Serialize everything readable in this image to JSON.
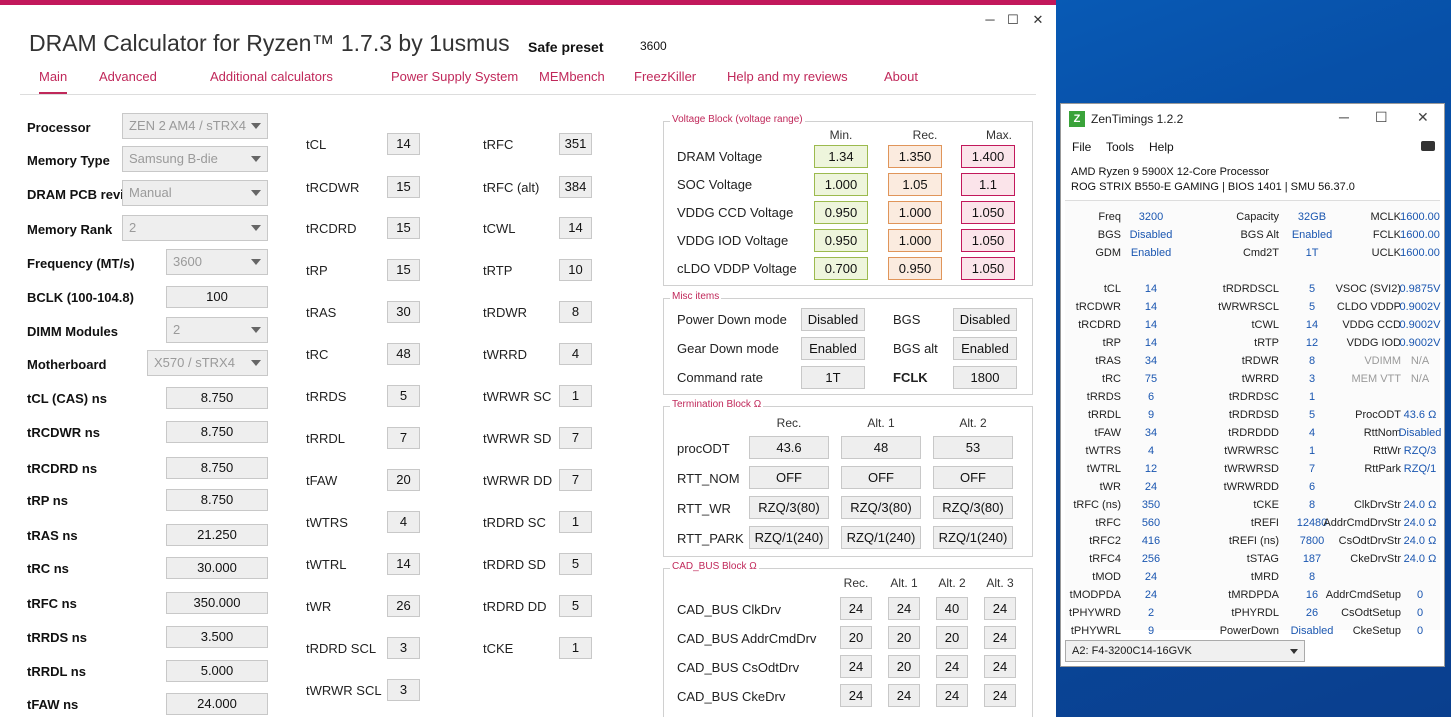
{
  "calc": {
    "title": "DRAM Calculator for Ryzen™ 1.7.3 by 1usmus",
    "preset_label": "Safe preset",
    "preset_value": "3600",
    "tabs": [
      "Main",
      "Advanced",
      "Additional calculators",
      "Power Supply System",
      "MEMbench",
      "FreezKiller",
      "Help and my reviews",
      "About"
    ],
    "settings": [
      {
        "label": "Processor",
        "value": "ZEN 2 AM4 / sTRX4",
        "type": "select"
      },
      {
        "label": "Memory Type",
        "value": "Samsung B-die",
        "type": "select"
      },
      {
        "label": "DRAM PCB revision",
        "value": "Manual",
        "type": "select"
      },
      {
        "label": "Memory Rank",
        "value": "2",
        "type": "select"
      },
      {
        "label": "Frequency (MT/s)",
        "value": "3600",
        "type": "select"
      },
      {
        "label": "BCLK (100-104.8)",
        "value": "100",
        "type": "input"
      },
      {
        "label": "DIMM Modules",
        "value": "2",
        "type": "select"
      },
      {
        "label": "Motherboard",
        "value": "X570 / sTRX4",
        "type": "select"
      },
      {
        "label": "tCL (CAS) ns",
        "value": "8.750",
        "type": "input"
      },
      {
        "label": "tRCDWR ns",
        "value": "8.750",
        "type": "input"
      },
      {
        "label": "tRCDRD ns",
        "value": "8.750",
        "type": "input"
      },
      {
        "label": "tRP ns",
        "value": "8.750",
        "type": "input"
      },
      {
        "label": "tRAS ns",
        "value": "21.250",
        "type": "input"
      },
      {
        "label": "tRC ns",
        "value": "30.000",
        "type": "input"
      },
      {
        "label": "tRFC ns",
        "value": "350.000",
        "type": "input"
      },
      {
        "label": "tRRDS ns",
        "value": "3.500",
        "type": "input"
      },
      {
        "label": "tRRDL ns",
        "value": "5.000",
        "type": "input"
      },
      {
        "label": "tFAW ns",
        "value": "24.000",
        "type": "input"
      }
    ],
    "timings_col1": [
      {
        "label": "tCL",
        "value": "14"
      },
      {
        "label": "tRCDWR",
        "value": "15"
      },
      {
        "label": "tRCDRD",
        "value": "15"
      },
      {
        "label": "tRP",
        "value": "15"
      },
      {
        "label": "tRAS",
        "value": "30"
      },
      {
        "label": "tRC",
        "value": "48"
      },
      {
        "label": "tRRDS",
        "value": "5"
      },
      {
        "label": "tRRDL",
        "value": "7"
      },
      {
        "label": "tFAW",
        "value": "20"
      },
      {
        "label": "tWTRS",
        "value": "4"
      },
      {
        "label": "tWTRL",
        "value": "14"
      },
      {
        "label": "tWR",
        "value": "26"
      },
      {
        "label": "tRDRD SCL",
        "value": "3"
      },
      {
        "label": "tWRWR SCL",
        "value": "3"
      }
    ],
    "timings_col2": [
      {
        "label": "tRFC",
        "value": "351"
      },
      {
        "label": "tRFC (alt)",
        "value": "384"
      },
      {
        "label": "tCWL",
        "value": "14"
      },
      {
        "label": "tRTP",
        "value": "10"
      },
      {
        "label": "tRDWR",
        "value": "8"
      },
      {
        "label": "tWRRD",
        "value": "4"
      },
      {
        "label": "tWRWR SC",
        "value": "1"
      },
      {
        "label": "tWRWR SD",
        "value": "7"
      },
      {
        "label": "tWRWR DD",
        "value": "7"
      },
      {
        "label": "tRDRD SC",
        "value": "1"
      },
      {
        "label": "tRDRD SD",
        "value": "5"
      },
      {
        "label": "tRDRD DD",
        "value": "5"
      },
      {
        "label": "tCKE",
        "value": "1"
      }
    ],
    "voltage": {
      "title": "Voltage Block (voltage range)",
      "headers": [
        "Min.",
        "Rec.",
        "Max."
      ],
      "rows": [
        {
          "label": "DRAM Voltage",
          "min": "1.34",
          "rec": "1.350",
          "max": "1.400"
        },
        {
          "label": "SOC Voltage",
          "min": "1.000",
          "rec": "1.05",
          "max": "1.1"
        },
        {
          "label": "VDDG  CCD Voltage",
          "min": "0.950",
          "rec": "1.000",
          "max": "1.050"
        },
        {
          "label": "VDDG  IOD Voltage",
          "min": "0.950",
          "rec": "1.000",
          "max": "1.050"
        },
        {
          "label": "cLDO VDDP Voltage",
          "min": "0.700",
          "rec": "0.950",
          "max": "1.050"
        }
      ]
    },
    "misc": {
      "title": "Misc items",
      "rows": [
        {
          "l1": "Power Down mode",
          "v1": "Disabled",
          "l2": "BGS",
          "v2": "Disabled"
        },
        {
          "l1": "Gear Down mode",
          "v1": "Enabled",
          "l2": "BGS alt",
          "v2": "Enabled"
        },
        {
          "l1": "Command rate",
          "v1": "1T",
          "l2": "FCLK",
          "v2": "1800"
        }
      ]
    },
    "termination": {
      "title": "Termination Block Ω",
      "headers": [
        "Rec.",
        "Alt. 1",
        "Alt. 2"
      ],
      "rows": [
        {
          "label": "procODT",
          "v": [
            "43.6",
            "48",
            "53"
          ]
        },
        {
          "label": "RTT_NOM",
          "v": [
            "OFF",
            "OFF",
            "OFF"
          ]
        },
        {
          "label": "RTT_WR",
          "v": [
            "RZQ/3(80)",
            "RZQ/3(80)",
            "RZQ/3(80)"
          ]
        },
        {
          "label": "RTT_PARK",
          "v": [
            "RZQ/1(240)",
            "RZQ/1(240)",
            "RZQ/1(240)"
          ]
        }
      ]
    },
    "cadbus": {
      "title": "CAD_BUS Block Ω",
      "headers": [
        "Rec.",
        "Alt. 1",
        "Alt. 2",
        "Alt. 3"
      ],
      "rows": [
        {
          "label": "CAD_BUS ClkDrv",
          "v": [
            "24",
            "24",
            "40",
            "24"
          ]
        },
        {
          "label": "CAD_BUS AddrCmdDrv",
          "v": [
            "20",
            "20",
            "20",
            "24"
          ]
        },
        {
          "label": "CAD_BUS CsOdtDrv",
          "v": [
            "24",
            "20",
            "24",
            "24"
          ]
        },
        {
          "label": "CAD_BUS CkeDrv",
          "v": [
            "24",
            "24",
            "24",
            "24"
          ]
        }
      ]
    }
  },
  "zen": {
    "title": "ZenTimings 1.2.2",
    "menu": [
      "File",
      "Tools",
      "Help"
    ],
    "cpu": "AMD Ryzen 9 5900X 12-Core Processor",
    "board": "ROG STRIX B550-E GAMING | BIOS 1401 | SMU 56.37.0",
    "rows": [
      [
        "Freq",
        "3200",
        "Capacity",
        "32GB",
        "MCLK",
        "1600.00"
      ],
      [
        "BGS",
        "Disabled",
        "BGS Alt",
        "Enabled",
        "FCLK",
        "1600.00"
      ],
      [
        "GDM",
        "Enabled",
        "Cmd2T",
        "1T",
        "UCLK",
        "1600.00"
      ],
      [
        "",
        "",
        "",
        "",
        "",
        ""
      ],
      [
        "tCL",
        "14",
        "tRDRDSCL",
        "5",
        "VSOC (SVI2)",
        "0.9875V"
      ],
      [
        "tRCDWR",
        "14",
        "tWRWRSCL",
        "5",
        "CLDO VDDP",
        "0.9002V"
      ],
      [
        "tRCDRD",
        "14",
        "tCWL",
        "14",
        "VDDG CCD",
        "0.9002V"
      ],
      [
        "tRP",
        "14",
        "tRTP",
        "12",
        "VDDG IOD",
        "0.9002V"
      ],
      [
        "tRAS",
        "34",
        "tRDWR",
        "8",
        "VDIMM",
        "N/A"
      ],
      [
        "tRC",
        "75",
        "tWRRD",
        "3",
        "MEM VTT",
        "N/A"
      ],
      [
        "tRRDS",
        "6",
        "tRDRDSC",
        "1",
        "",
        ""
      ],
      [
        "tRRDL",
        "9",
        "tRDRDSD",
        "5",
        "ProcODT",
        "43.6 Ω"
      ],
      [
        "tFAW",
        "34",
        "tRDRDDD",
        "4",
        "RttNom",
        "Disabled"
      ],
      [
        "tWTRS",
        "4",
        "tWRWRSC",
        "1",
        "RttWr",
        "RZQ/3"
      ],
      [
        "tWTRL",
        "12",
        "tWRWRSD",
        "7",
        "RttPark",
        "RZQ/1"
      ],
      [
        "tWR",
        "24",
        "tWRWRDD",
        "6",
        "",
        ""
      ],
      [
        "tRFC (ns)",
        "350",
        "tCKE",
        "8",
        "ClkDrvStr",
        "24.0 Ω"
      ],
      [
        "tRFC",
        "560",
        "tREFI",
        "12480",
        "AddrCmdDrvStr",
        "24.0 Ω"
      ],
      [
        "tRFC2",
        "416",
        "tREFI (ns)",
        "7800",
        "CsOdtDrvStr",
        "24.0 Ω"
      ],
      [
        "tRFC4",
        "256",
        "tSTAG",
        "187",
        "CkeDrvStr",
        "24.0 Ω"
      ],
      [
        "tMOD",
        "24",
        "tMRD",
        "8",
        "",
        ""
      ],
      [
        "tMODPDA",
        "24",
        "tMRDPDA",
        "16",
        "AddrCmdSetup",
        "0"
      ],
      [
        "tPHYWRD",
        "2",
        "tPHYRDL",
        "26",
        "CsOdtSetup",
        "0"
      ],
      [
        "tPHYWRL",
        "9",
        "PowerDown",
        "Disabled",
        "CkeSetup",
        "0"
      ]
    ],
    "module": "A2: F4-3200C14-16GVK"
  }
}
